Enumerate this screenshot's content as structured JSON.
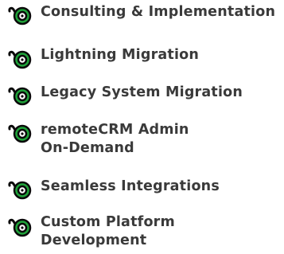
{
  "colors": {
    "icon_green": "#1fa53a",
    "icon_stroke": "#0a0a0a",
    "text": "#3a3a3a"
  },
  "icon_name": "target-check-icon",
  "services": [
    {
      "lines": [
        "Consulting & Implementation"
      ]
    },
    {
      "lines": [
        "Lightning Migration"
      ]
    },
    {
      "lines": [
        "Legacy System Migration"
      ]
    },
    {
      "lines": [
        "remoteCRM Admin",
        "On-Demand"
      ]
    },
    {
      "lines": [
        "Seamless Integrations"
      ]
    },
    {
      "lines": [
        "Custom Platform",
        "Development"
      ]
    }
  ]
}
